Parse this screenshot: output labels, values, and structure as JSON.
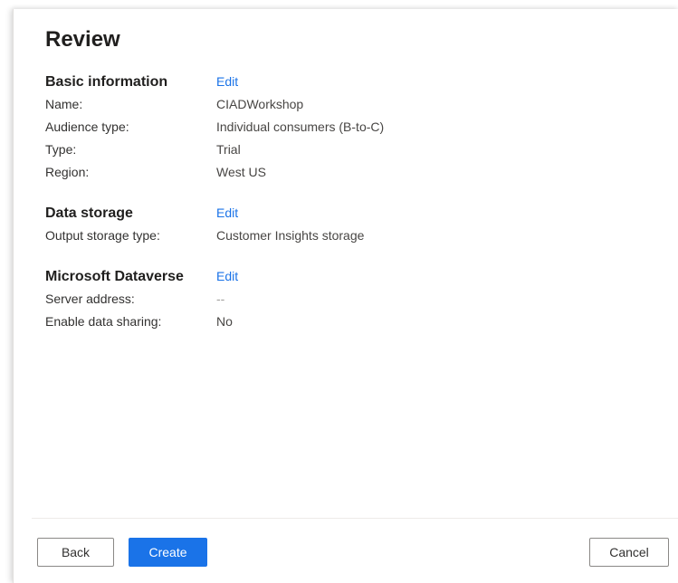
{
  "title": "Review",
  "basic_info": {
    "heading": "Basic information",
    "edit_label": "Edit",
    "fields": [
      {
        "label": "Name:",
        "value": "CIADWorkshop"
      },
      {
        "label": "Audience type:",
        "value": "Individual consumers (B-to-C)"
      },
      {
        "label": "Type:",
        "value": "Trial"
      },
      {
        "label": "Region:",
        "value": "West US"
      }
    ]
  },
  "data_storage": {
    "heading": "Data storage",
    "edit_label": "Edit",
    "fields": [
      {
        "label": "Output storage type:",
        "value": "Customer Insights storage"
      }
    ]
  },
  "dataverse": {
    "heading": "Microsoft Dataverse",
    "edit_label": "Edit",
    "fields": [
      {
        "label": "Server address:",
        "value": "--"
      },
      {
        "label": "Enable data sharing:",
        "value": "No"
      }
    ]
  },
  "footer": {
    "back_label": "Back",
    "create_label": "Create",
    "cancel_label": "Cancel"
  },
  "colors": {
    "accent": "#1a73e8",
    "text": "#323130"
  }
}
